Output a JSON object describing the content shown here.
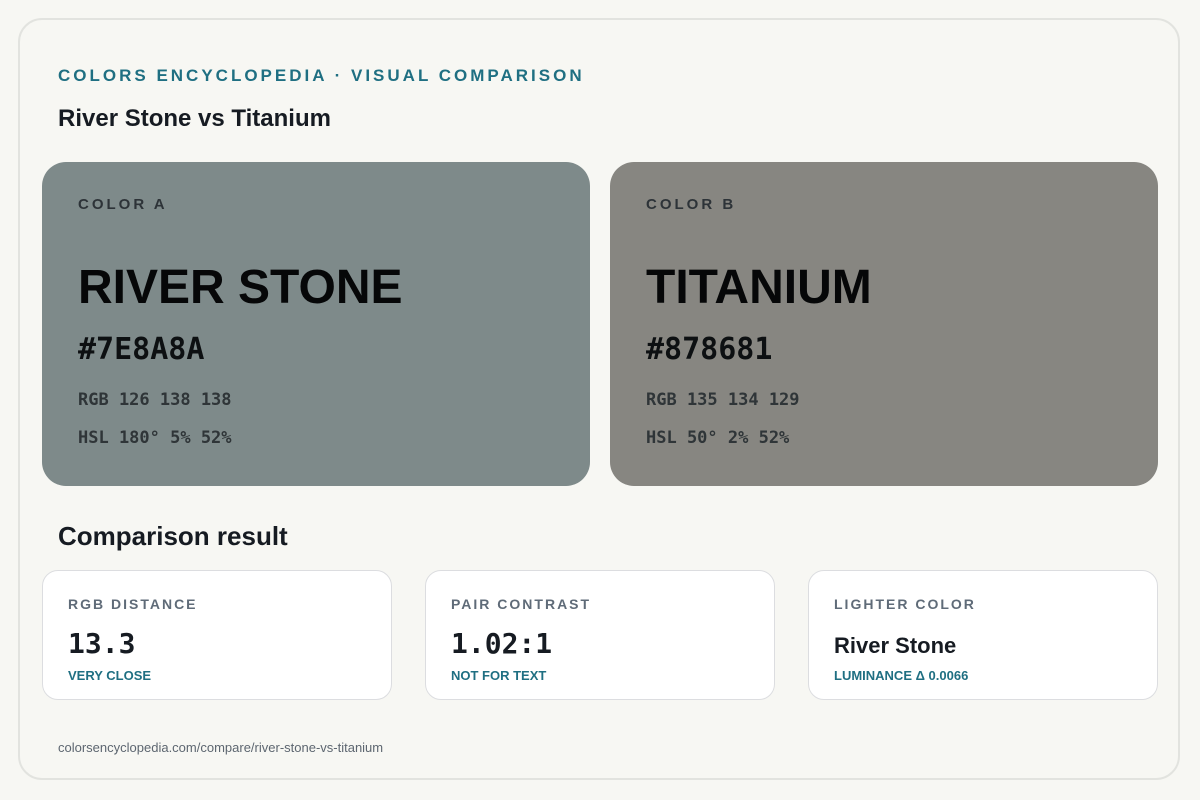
{
  "header": {
    "eyebrow": "COLORS ENCYCLOPEDIA · VISUAL COMPARISON",
    "title": "River Stone vs Titanium"
  },
  "colors": [
    {
      "eyebrow": "COLOR A",
      "name": "RIVER STONE",
      "hex": "#7E8A8A",
      "rgb": "RGB 126 138 138",
      "hsl": "HSL 180° 5% 52%",
      "swatch_color": "#7e8a8a"
    },
    {
      "eyebrow": "COLOR B",
      "name": "TITANIUM",
      "hex": "#878681",
      "rgb": "RGB 135 134 129",
      "hsl": "HSL 50° 2% 52%",
      "swatch_color": "#878681"
    }
  ],
  "comparison": {
    "title": "Comparison result",
    "cards": [
      {
        "label": "RGB DISTANCE",
        "value": "13.3",
        "note": "VERY CLOSE"
      },
      {
        "label": "PAIR CONTRAST",
        "value": "1.02:1",
        "note": "NOT FOR TEXT"
      },
      {
        "label": "LIGHTER COLOR",
        "value": "River Stone",
        "note": "LUMINANCE Δ 0.0066"
      }
    ]
  },
  "footer": {
    "url": "colorsencyclopedia.com/compare/river-stone-vs-titanium"
  },
  "theme": {
    "accent": "#1f6f82",
    "background": "#f7f7f3"
  }
}
